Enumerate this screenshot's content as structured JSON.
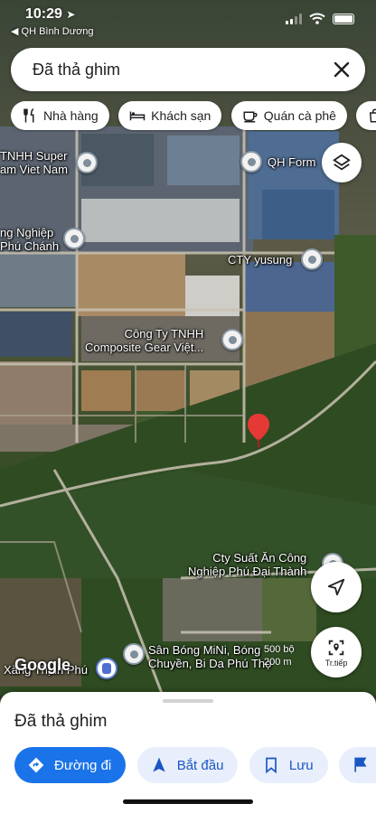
{
  "status_bar": {
    "time": "10:29",
    "back_app": "◀ QH Bình Dương"
  },
  "search": {
    "text": "Đã thả ghim"
  },
  "chips": [
    {
      "label": "Nhà hàng",
      "icon": "fork-knife-icon"
    },
    {
      "label": "Khách sạn",
      "icon": "bed-icon"
    },
    {
      "label": "Quán cà phê",
      "icon": "coffee-cup-icon"
    }
  ],
  "map_labels": {
    "super_vietnam": "TNHH Super\nam Viet Nam",
    "qh_form": "QH Form",
    "nghiep_phu_chanh": "ng Nghiệp\nPhú Chánh",
    "cty_yusung": "CTY yusung",
    "composite_gear": "Công Ty TNHH\nComposite Gear Việt...",
    "suat_an": "Cty Suất Ăn Công\nNghiệp Phú Đại Thành",
    "san_bong": "Sân Bóng MiNi, Bóng\nChuyền, Bi Da Phú Thọ",
    "xang": "Xăng Thịnh Phú"
  },
  "map_overlay": {
    "google": "Google",
    "scale": "500 bộ\n200 m",
    "next_label": "Tr.tiếp"
  },
  "sheet": {
    "title": "Đã thả ghim",
    "actions": [
      {
        "label": "Đường đi",
        "icon": "directions-icon",
        "primary": true
      },
      {
        "label": "Bắt đầu",
        "icon": "navigation-arrow-icon",
        "primary": false
      },
      {
        "label": "Lưu",
        "icon": "bookmark-icon",
        "primary": false
      },
      {
        "label": "Th",
        "icon": "flag-icon",
        "primary": false
      }
    ]
  },
  "colors": {
    "accent": "#1a73e8",
    "pin_red": "#e53935"
  }
}
